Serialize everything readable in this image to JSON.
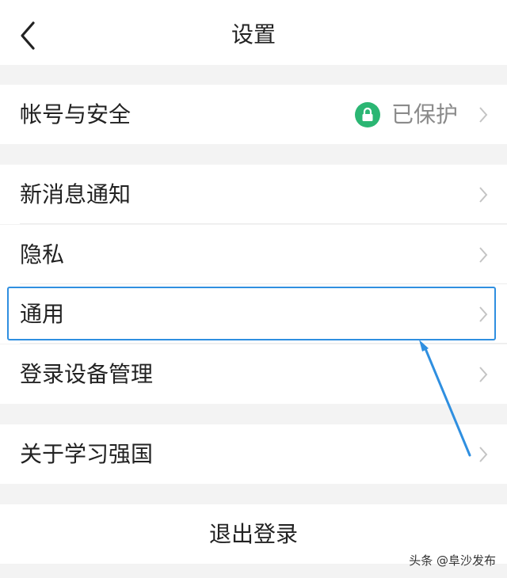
{
  "header": {
    "title": "设置"
  },
  "account": {
    "label": "帐号与安全",
    "status": "已保护"
  },
  "menu": [
    {
      "label": "新消息通知"
    },
    {
      "label": "隐私"
    },
    {
      "label": "通用"
    },
    {
      "label": "登录设备管理"
    }
  ],
  "about": {
    "label": "关于学习强国"
  },
  "logout": {
    "label": "退出登录"
  },
  "watermark": "头条 @阜沙发布",
  "colors": {
    "lock_badge": "#2bb673",
    "highlight": "#2f8fe0",
    "background": "#f3f3f3"
  },
  "icons": {
    "back": "chevron-left-icon",
    "row_arrow": "chevron-right-icon",
    "lock": "lock-icon"
  }
}
